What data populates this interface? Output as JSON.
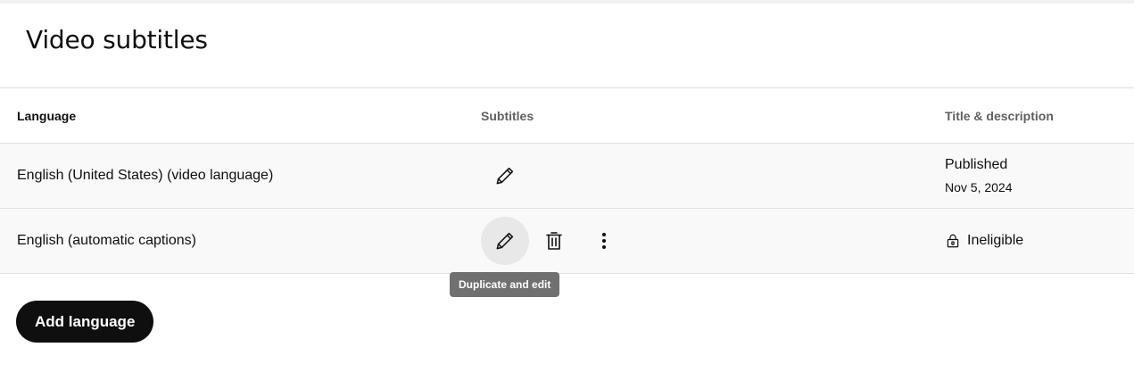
{
  "page": {
    "title": "Video subtitles"
  },
  "table": {
    "headers": {
      "language": "Language",
      "subtitles": "Subtitles",
      "title_description": "Title & description"
    },
    "rows": [
      {
        "language": "English (United States) (video language)",
        "subtitle_actions": [
          "pencil-icon"
        ],
        "title_status": "Published",
        "title_date": "Nov 5, 2024"
      },
      {
        "language": "English (automatic captions)",
        "subtitle_actions": [
          "pencil-icon",
          "trash-icon",
          "more-vert-icon"
        ],
        "title_status": "Ineligible",
        "title_status_icon": "lock-icon"
      }
    ]
  },
  "tooltip": {
    "text": "Duplicate and edit"
  },
  "actions": {
    "add_language_label": "Add language"
  },
  "colors": {
    "primary_button_bg": "#0f0f0f",
    "primary_button_text": "#ffffff",
    "row_bg": "#f9f9f9",
    "divider": "#e0e0e0",
    "tooltip_bg": "#707070",
    "hover_circle": "#e8e8e8",
    "secondary_text": "#606060"
  }
}
